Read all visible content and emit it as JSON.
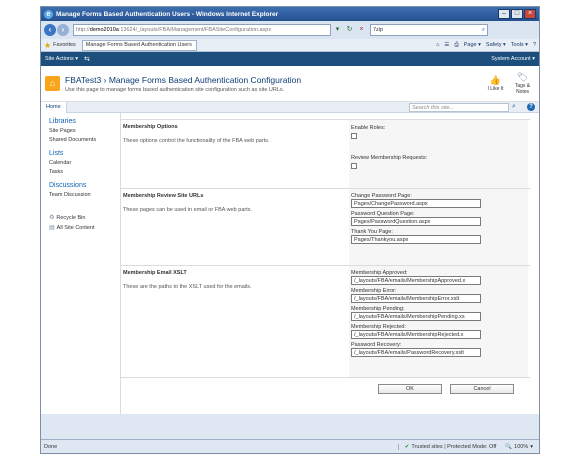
{
  "window": {
    "title": "Manage Forms Based Authentication Users - Windows Internet Explorer"
  },
  "address_bar": {
    "url_prefix": "http://",
    "url_host": "demo2010a",
    "url_path": ":13624/_layouts/FBA/Management/FBASiteConfiguration.aspx",
    "search_value": "7zip"
  },
  "favorites_bar": {
    "favorites_label": "Favorites",
    "tab_title": "Manage Forms Based Authentication Users",
    "page_menu": "Page ▾",
    "safety_menu": "Safety ▾",
    "tools_menu": "Tools ▾",
    "help_menu": "?"
  },
  "ribbon": {
    "site_actions": "Site Actions ▾",
    "system_account": "System Account ▾"
  },
  "title_area": {
    "site_name": "FBATest3",
    "separator": "›",
    "page_title": "Manage Forms Based Authentication Configuration",
    "description": "Use this page to manage forms based authentication site configuration such as site URLs.",
    "i_like_it": "I Like It",
    "tags_notes": "Tags & Notes"
  },
  "top_nav": {
    "home_tab": "Home",
    "search_placeholder": "Search this site..."
  },
  "quick_launch": {
    "libraries": "Libraries",
    "site_pages": "Site Pages",
    "shared_documents": "Shared Documents",
    "lists": "Lists",
    "calendar": "Calendar",
    "tasks": "Tasks",
    "discussions": "Discussions",
    "team_discussion": "Team Discussion",
    "recycle_bin": "Recycle Bin",
    "all_site_content": "All Site Content"
  },
  "sections": {
    "membership_options": {
      "title": "Membership Options",
      "description": "These options control the functionality of the FBA web parts.",
      "enable_roles_label": "Enable Roles:",
      "review_requests_label": "Review Membership Requests:"
    },
    "review_site_urls": {
      "title": "Membership Review Site URLs",
      "description": "These pages can be used in email or FBA web parts.",
      "change_password_label": "Change Password Page:",
      "change_password_value": "Pages/ChangePassword.aspx",
      "password_question_label": "Password Question Page:",
      "password_question_value": "Pages/PasswordQuestion.aspx",
      "thank_you_label": "Thank You Page:",
      "thank_you_value": "Pages/Thankyou.aspx"
    },
    "email_xslt": {
      "title": "Membership Email XSLT",
      "description": "These are the paths to the XSLT used for the emails.",
      "approved_label": "Membership Approved:",
      "approved_value": "/_layouts/FBA/emails/MembershipApproved.x",
      "error_label": "Membership Error:",
      "error_value": "/_layouts/FBA/emails/MembershipError.xslt",
      "pending_label": "Membership Pending:",
      "pending_value": "/_layouts/FBA/emails/MembershipPending.xs",
      "rejected_label": "Membership Rejected:",
      "rejected_value": "/_layouts/FBA/emails/MembershipRejected.x",
      "recovery_label": "Password Recovery:",
      "recovery_value": "/_layouts/FBA/emails/PasswordRecovery.xslt"
    }
  },
  "buttons": {
    "ok": "OK",
    "cancel": "Cancel"
  },
  "status_bar": {
    "status_text": "Done",
    "zone_text": "Trusted sites | Protected Mode: Off",
    "zoom_text": "100%"
  }
}
